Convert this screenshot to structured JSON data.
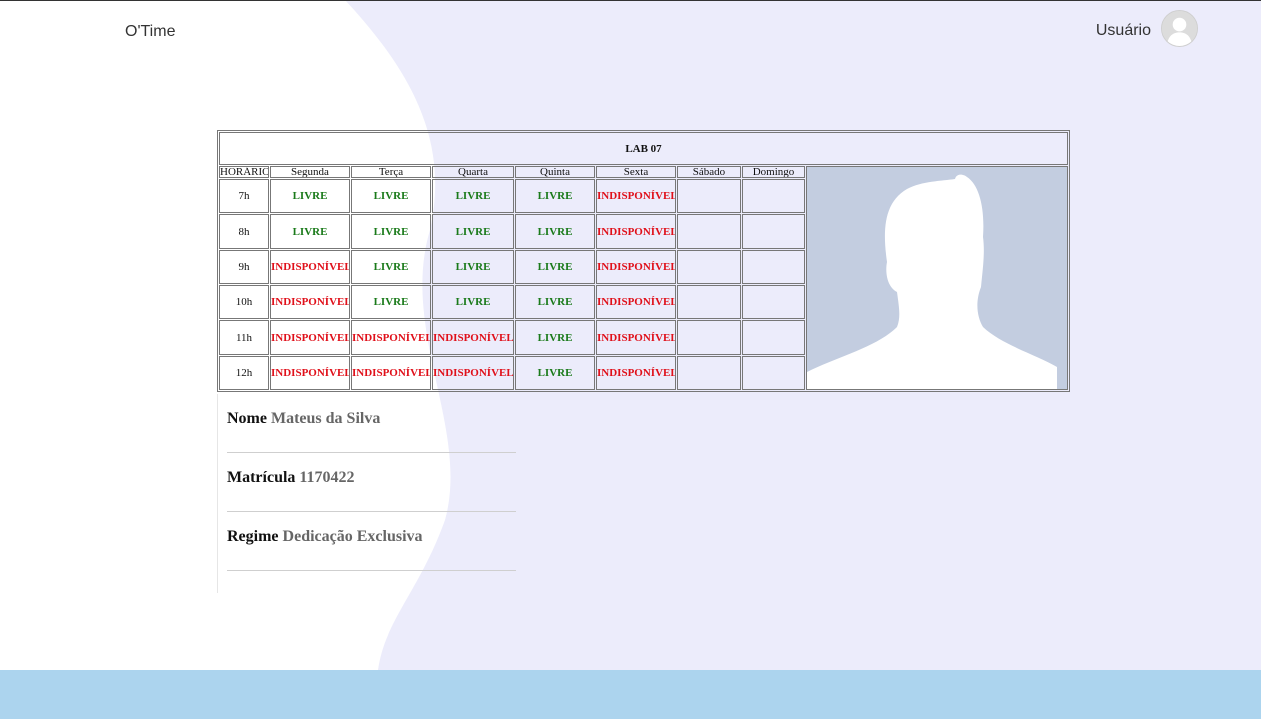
{
  "header": {
    "brand": "O'Time",
    "user_label": "Usuário"
  },
  "schedule": {
    "title": "LAB 07",
    "columns": [
      "HORÁRIO",
      "Segunda",
      "Terça",
      "Quarta",
      "Quinta",
      "Sexta",
      "Sábado",
      "Domingo"
    ],
    "rows": [
      {
        "hour": "7h",
        "cells": [
          "LIVRE",
          "LIVRE",
          "LIVRE",
          "LIVRE",
          "INDISPONÍVEL",
          "",
          ""
        ]
      },
      {
        "hour": "8h",
        "cells": [
          "LIVRE",
          "LIVRE",
          "LIVRE",
          "LIVRE",
          "INDISPONÍVEL",
          "",
          ""
        ]
      },
      {
        "hour": "9h",
        "cells": [
          "INDISPONÍVEL",
          "LIVRE",
          "LIVRE",
          "LIVRE",
          "INDISPONÍVEL",
          "",
          ""
        ]
      },
      {
        "hour": "10h",
        "cells": [
          "INDISPONÍVEL",
          "LIVRE",
          "LIVRE",
          "LIVRE",
          "INDISPONÍVEL",
          "",
          ""
        ]
      },
      {
        "hour": "11h",
        "cells": [
          "INDISPONÍVEL",
          "INDISPONÍVEL",
          "INDISPONÍVEL",
          "LIVRE",
          "INDISPONÍVEL",
          "",
          ""
        ]
      },
      {
        "hour": "12h",
        "cells": [
          "INDISPONÍVEL",
          "INDISPONÍVEL",
          "INDISPONÍVEL",
          "LIVRE",
          "INDISPONÍVEL",
          "",
          ""
        ]
      }
    ]
  },
  "profile": {
    "photo_icon": "user-silhouette-icon",
    "fields": [
      {
        "label": "Nome",
        "value": "Mateus da Silva"
      },
      {
        "label": "Matrícula",
        "value": "1170422"
      },
      {
        "label": "Regime",
        "value": "Dedicação Exclusiva"
      }
    ]
  },
  "colors": {
    "accent_bg": "#ececfb",
    "footer": "#acd4ee",
    "livre": "#1a7a1a",
    "indisponivel": "#e0101a",
    "photo_bg": "#c3cde0"
  }
}
